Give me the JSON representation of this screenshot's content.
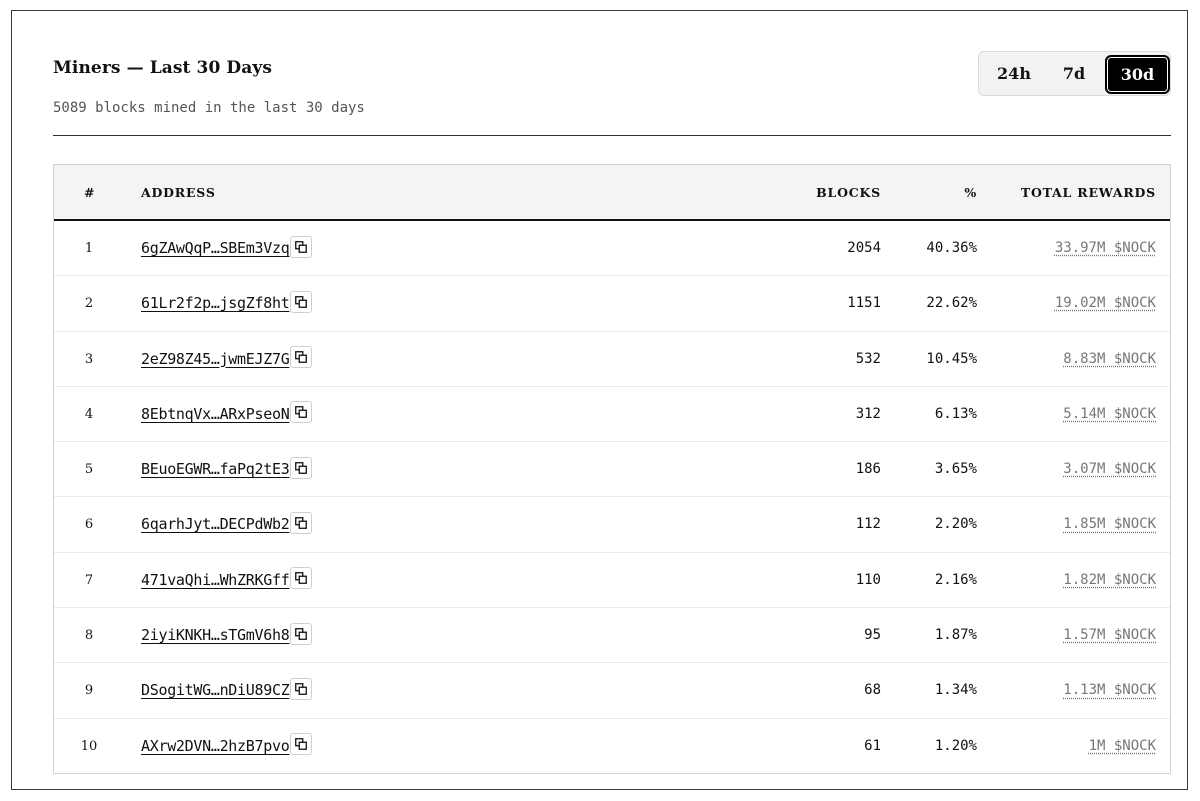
{
  "header": {
    "title": "Miners — Last 30 Days",
    "subtitle": "5089 blocks mined in the last 30 days"
  },
  "range_toggle": {
    "options": [
      "24h",
      "7d",
      "30d"
    ],
    "selected": "30d"
  },
  "table": {
    "columns": {
      "rank": "#",
      "address": "ADDRESS",
      "blocks": "BLOCKS",
      "percent": "%",
      "total_rewards": "TOTAL REWARDS"
    },
    "rows": [
      {
        "rank": "1",
        "address": "6gZAwQqP…SBEm3Vzq",
        "blocks": "2054",
        "percent": "40.36%",
        "rewards": "33.97M $NOCK"
      },
      {
        "rank": "2",
        "address": "61Lr2f2p…jsgZf8ht",
        "blocks": "1151",
        "percent": "22.62%",
        "rewards": "19.02M $NOCK"
      },
      {
        "rank": "3",
        "address": "2eZ98Z45…jwmEJZ7G",
        "blocks": "532",
        "percent": "10.45%",
        "rewards": "8.83M $NOCK"
      },
      {
        "rank": "4",
        "address": "8EbtnqVx…ARxPseoN",
        "blocks": "312",
        "percent": "6.13%",
        "rewards": "5.14M $NOCK"
      },
      {
        "rank": "5",
        "address": "BEuoEGWR…faPq2tE3",
        "blocks": "186",
        "percent": "3.65%",
        "rewards": "3.07M $NOCK"
      },
      {
        "rank": "6",
        "address": "6qarhJyt…DECPdWb2",
        "blocks": "112",
        "percent": "2.20%",
        "rewards": "1.85M $NOCK"
      },
      {
        "rank": "7",
        "address": "471vaQhi…WhZRKGff",
        "blocks": "110",
        "percent": "2.16%",
        "rewards": "1.82M $NOCK"
      },
      {
        "rank": "8",
        "address": "2iyiKNKH…sTGmV6h8",
        "blocks": "95",
        "percent": "1.87%",
        "rewards": "1.57M $NOCK"
      },
      {
        "rank": "9",
        "address": "DSogitWG…nDiU89CZ",
        "blocks": "68",
        "percent": "1.34%",
        "rewards": "1.13M $NOCK"
      },
      {
        "rank": "10",
        "address": "AXrw2DVN…2hzB7pvo",
        "blocks": "61",
        "percent": "1.20%",
        "rewards": "1M $NOCK"
      }
    ]
  },
  "icons": {
    "copy": "copy-icon"
  },
  "colors": {
    "selected_toggle_bg": "#000000",
    "rewards_text": "#777777"
  }
}
